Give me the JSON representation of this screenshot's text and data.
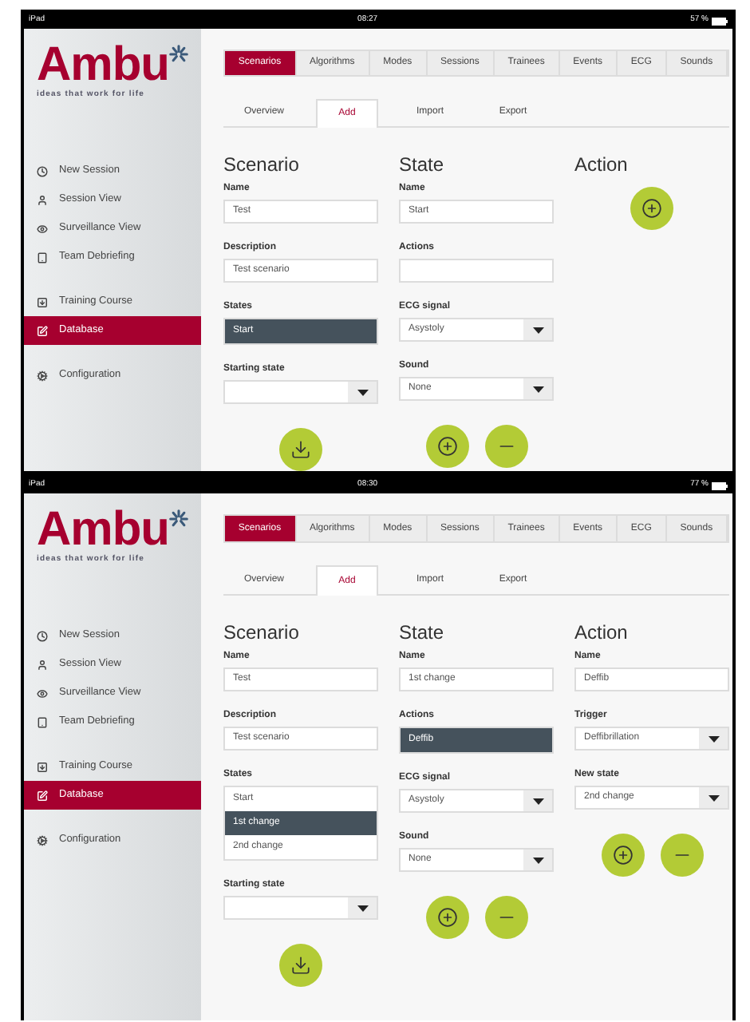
{
  "screens": [
    {
      "status": {
        "carrier": "iPad",
        "time": "08:27",
        "battery": "57 %"
      },
      "logo": {
        "name": "Ambu",
        "tagline": "ideas that work for life"
      },
      "sidebar": {
        "groups": [
          {
            "items": [
              {
                "label": "New Session",
                "selected": false
              },
              {
                "label": "Session View",
                "selected": false
              },
              {
                "label": "Surveillance View",
                "selected": false
              },
              {
                "label": "Team Debriefing",
                "selected": false
              }
            ]
          },
          {
            "items": [
              {
                "label": "Training Course",
                "selected": false
              },
              {
                "label": "Database",
                "selected": true
              }
            ]
          },
          {
            "items": [
              {
                "label": "Configuration",
                "selected": false
              }
            ]
          }
        ]
      },
      "tabs": [
        {
          "label": "Scenarios",
          "selected": true
        },
        {
          "label": "Algorithms",
          "selected": false
        },
        {
          "label": "Modes",
          "selected": false
        },
        {
          "label": "Sessions",
          "selected": false
        },
        {
          "label": "Trainees",
          "selected": false
        },
        {
          "label": "Events",
          "selected": false
        },
        {
          "label": "ECG",
          "selected": false
        },
        {
          "label": "Sounds",
          "selected": false
        }
      ],
      "sub_tabs": [
        {
          "label": "Overview",
          "selected": false
        },
        {
          "label": "Add",
          "selected": true
        },
        {
          "label": "Import",
          "selected": false
        },
        {
          "label": "Export",
          "selected": false
        }
      ],
      "columns": [
        {
          "heading": "Scenario",
          "fields": [
            {
              "kind": "text",
              "label": "Name",
              "value": "Test"
            },
            {
              "kind": "text",
              "label": "Description",
              "value": "Test scenario"
            },
            {
              "kind": "list",
              "label": "States",
              "items": [
                {
                  "label": "Start",
                  "selected": true
                }
              ]
            },
            {
              "kind": "select",
              "label": "Starting state"
            }
          ],
          "buttons": [
            {
              "kind": "save"
            }
          ]
        },
        {
          "heading": "State",
          "fields": [
            {
              "kind": "text",
              "label": "Name",
              "value": "Start"
            },
            {
              "kind": "text",
              "label": "Actions"
            },
            {
              "kind": "select",
              "label": "ECG signal",
              "value": "Asystoly"
            },
            {
              "kind": "select",
              "label": "Sound",
              "value": "None"
            }
          ],
          "buttons": [
            {
              "kind": "add"
            },
            {
              "kind": "remove"
            }
          ]
        },
        {
          "heading": "Action",
          "buttons": [
            {
              "kind": "add"
            }
          ]
        }
      ]
    },
    {
      "status": {
        "carrier": "iPad",
        "time": "08:30",
        "battery": "77 %"
      },
      "logo": {
        "name": "Ambu",
        "tagline": "ideas that work for life"
      },
      "sidebar": {
        "groups": [
          {
            "items": [
              {
                "label": "New Session",
                "selected": false
              },
              {
                "label": "Session View",
                "selected": false
              },
              {
                "label": "Surveillance View",
                "selected": false
              },
              {
                "label": "Team Debriefing",
                "selected": false
              }
            ]
          },
          {
            "items": [
              {
                "label": "Training Course",
                "selected": false
              },
              {
                "label": "Database",
                "selected": true
              }
            ]
          },
          {
            "items": [
              {
                "label": "Configuration",
                "selected": false
              }
            ]
          }
        ]
      },
      "tabs": [
        {
          "label": "Scenarios",
          "selected": true
        },
        {
          "label": "Algorithms",
          "selected": false
        },
        {
          "label": "Modes",
          "selected": false
        },
        {
          "label": "Sessions",
          "selected": false
        },
        {
          "label": "Trainees",
          "selected": false
        },
        {
          "label": "Events",
          "selected": false
        },
        {
          "label": "ECG",
          "selected": false
        },
        {
          "label": "Sounds",
          "selected": false
        }
      ],
      "sub_tabs": [
        {
          "label": "Overview",
          "selected": false
        },
        {
          "label": "Add",
          "selected": true
        },
        {
          "label": "Import",
          "selected": false
        },
        {
          "label": "Export",
          "selected": false
        }
      ],
      "columns": [
        {
          "heading": "Scenario",
          "fields": [
            {
              "kind": "text",
              "label": "Name",
              "value": "Test"
            },
            {
              "kind": "text",
              "label": "Description",
              "value": "Test scenario"
            },
            {
              "kind": "list",
              "label": "States",
              "items": [
                {
                  "label": "Start",
                  "selected": false
                },
                {
                  "label": "1st change",
                  "selected": true
                },
                {
                  "label": "2nd change",
                  "selected": false
                }
              ]
            },
            {
              "kind": "select",
              "label": "Starting state"
            }
          ],
          "buttons": [
            {
              "kind": "save"
            }
          ]
        },
        {
          "heading": "State",
          "fields": [
            {
              "kind": "text",
              "label": "Name",
              "value": "1st change"
            },
            {
              "kind": "list",
              "label": "Actions",
              "items": [
                {
                  "label": "Deffib",
                  "selected": true
                }
              ]
            },
            {
              "kind": "select",
              "label": "ECG signal",
              "value": "Asystoly"
            },
            {
              "kind": "select",
              "label": "Sound",
              "value": "None"
            }
          ],
          "buttons": [
            {
              "kind": "add"
            },
            {
              "kind": "remove"
            }
          ]
        },
        {
          "heading": "Action",
          "fields": [
            {
              "kind": "text",
              "label": "Name",
              "value": "Deffib"
            },
            {
              "kind": "select",
              "label": "Trigger",
              "value": "Deffibrillation"
            },
            {
              "kind": "select",
              "label": "New state",
              "value": "2nd change"
            }
          ],
          "buttons": [
            {
              "kind": "add"
            },
            {
              "kind": "remove"
            }
          ]
        }
      ]
    }
  ]
}
